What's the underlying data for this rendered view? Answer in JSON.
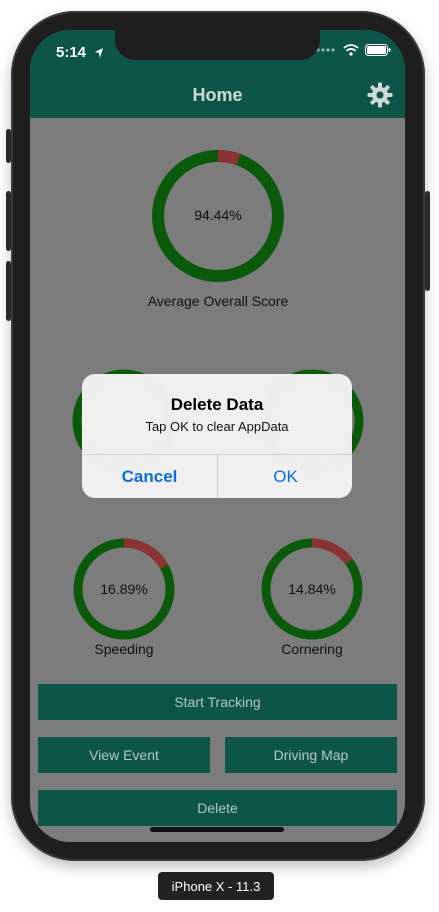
{
  "status_bar": {
    "time": "5:14"
  },
  "nav": {
    "title": "Home"
  },
  "gauges": {
    "overall": {
      "value_text": "94.44%",
      "fraction": 0.9444,
      "label": "Average Overall Score"
    },
    "speeding": {
      "value_text": "16.89%",
      "fraction": 0.8311,
      "label": "Speeding"
    },
    "cornering": {
      "value_text": "14.84%",
      "fraction": 0.8516,
      "label": "Cornering"
    }
  },
  "buttons": {
    "start_tracking": "Start Tracking",
    "view_event": "View Event",
    "driving_map": "Driving Map",
    "delete": "Delete"
  },
  "alert": {
    "title": "Delete Data",
    "message": "Tap OK to clear AppData",
    "cancel": "Cancel",
    "ok": "OK"
  },
  "device_label": "iPhone X - 11.3",
  "colors": {
    "nav": "#0d5548",
    "ring_good": "#0b5a0b",
    "ring_bad": "#8b3232",
    "screen_bg": "#7c7c7c",
    "alert_button": "#0a6fdc"
  }
}
